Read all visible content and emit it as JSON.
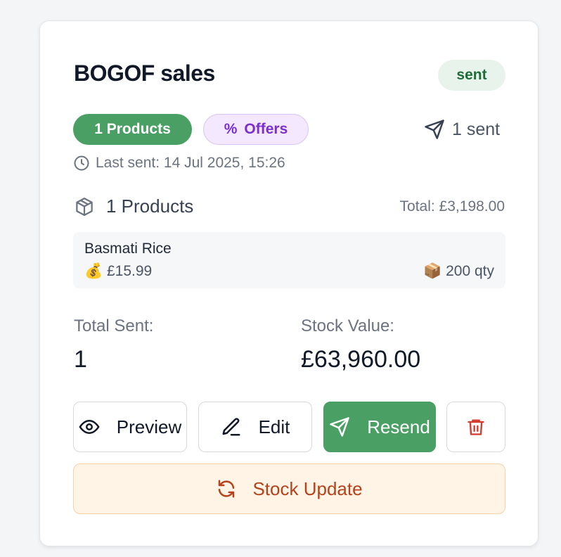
{
  "campaign": {
    "title": "BOGOF sales",
    "status": "sent",
    "tags": {
      "products": "1 Products",
      "offers": "Offers",
      "offers_symbol": "%"
    },
    "sent_count": "1 sent",
    "last_sent": "Last sent: 14 Jul 2025, 15:26"
  },
  "products": {
    "heading": "1 Products",
    "total": "Total: £3,198.00",
    "items": [
      {
        "name": "Basmati Rice",
        "price": "£15.99",
        "qty": "200 qty",
        "price_icon": "💰",
        "qty_icon": "📦"
      }
    ]
  },
  "stats": {
    "total_sent_label": "Total Sent:",
    "total_sent_value": "1",
    "stock_value_label": "Stock Value:",
    "stock_value_value": "£63,960.00"
  },
  "actions": {
    "preview": "Preview",
    "edit": "Edit",
    "resend": "Resend",
    "stock_update": "Stock Update"
  },
  "colors": {
    "green": "#4aa064",
    "status_bg": "#e8f3ec",
    "offers_purple": "#7b2fcf",
    "danger": "#d33a2c",
    "stock_orange": "#b5421a"
  }
}
